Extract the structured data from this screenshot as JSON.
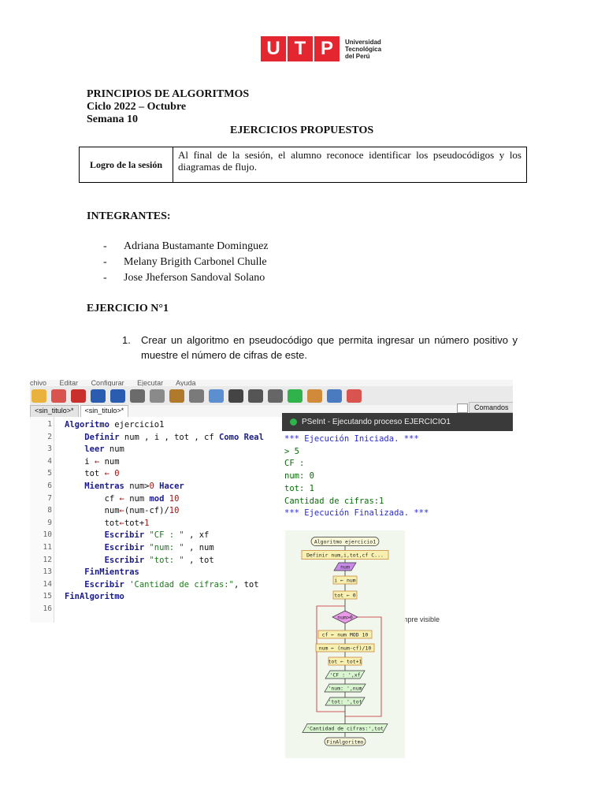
{
  "logo": {
    "letters": [
      "U",
      "T",
      "P"
    ],
    "name_lines": [
      "Universidad",
      "Tecnológica",
      "del Perú"
    ],
    "brand_color": "#e3262f"
  },
  "header": {
    "course": "PRINCIPIOS DE ALGORITMOS",
    "cycle": "Ciclo 2022 – Octubre",
    "week": "Semana 10",
    "title": "EJERCICIOS PROPUESTOS"
  },
  "logro": {
    "label": "Logro de la sesión",
    "text": "Al final de la sesión, el alumno reconoce identificar los pseudocódigos y los diagramas de flujo."
  },
  "integrantes": {
    "heading": "INTEGRANTES:",
    "members": [
      "Adriana Bustamante Dominguez",
      "Melany Brigith Carbonel Chulle",
      "Jose Jheferson Sandoval Solano"
    ]
  },
  "exercise": {
    "heading": "EJERCICIO N°1",
    "number": "1.",
    "statement": "Crear un algoritmo en pseudocódigo que permita ingresar un número positivo y muestre el número de cifras de este."
  },
  "ide": {
    "menu": [
      "chivo",
      "Editar",
      "Configurar",
      "Ejecutar",
      "Ayuda"
    ],
    "tabs": [
      "<sin_titulo>*",
      "<sin_titulo>*"
    ],
    "commands_label": "Comandos",
    "code": [
      {
        "n": "1",
        "t": "Algoritmo ejercicio1"
      },
      {
        "n": "2",
        "t": "    Definir num , i , tot , cf Como Real"
      },
      {
        "n": "3",
        "t": "    leer num"
      },
      {
        "n": "4",
        "t": "    i ← num"
      },
      {
        "n": "5",
        "t": "    tot ← 0"
      },
      {
        "n": "6",
        "t": "    Mientras num>0 Hacer"
      },
      {
        "n": "7",
        "t": "        cf ← num mod 10"
      },
      {
        "n": "8",
        "t": "        num←(num-cf)/10"
      },
      {
        "n": "9",
        "t": "        tot←tot+1"
      },
      {
        "n": "10",
        "t": "        Escribir \"CF : \" , xf"
      },
      {
        "n": "11",
        "t": "        Escribir \"num: \" , num"
      },
      {
        "n": "12",
        "t": "        Escribir \"tot: \" , tot"
      },
      {
        "n": "13",
        "t": "    FinMientras"
      },
      {
        "n": "14",
        "t": "    Escribir 'Cantidad de cifras:\", tot"
      },
      {
        "n": "15",
        "t": "FinAlgoritmo"
      },
      {
        "n": "16",
        "t": ""
      }
    ]
  },
  "console": {
    "title": "PSeInt - Ejecutando proceso EJERCICIO1",
    "lines": [
      "*** Ejecución Iniciada. ***",
      "> 5",
      "CF :",
      "num: 0",
      "tot: 1",
      "Cantidad de cifras:1",
      "*** Ejecución Finalizada. ***"
    ],
    "partial_note": "mpre visible"
  },
  "flowchart": {
    "nodes": [
      "Algoritmo ejercicio1",
      "Definir num,i,tot,cf C...",
      "num",
      "i ← num",
      "tot ← 0",
      "num>0",
      "cf ← num MOD 10",
      "num ← (num-cf)/10",
      "tot ← tot+1",
      "'CF : ',xf",
      "'num: ',num",
      "'tot: ',tot",
      "'Cantidad de cifras:',tot",
      "FinAlgoritmo"
    ]
  }
}
